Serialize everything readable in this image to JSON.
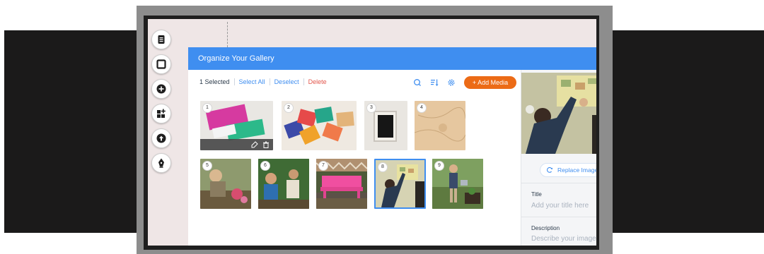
{
  "panel": {
    "title": "Organize Your Gallery",
    "selected_count": "1 Selected",
    "select_all": "Select All",
    "deselect": "Deselect",
    "delete": "Delete",
    "add_media": "+ Add Media"
  },
  "toolbar": {
    "items": [
      "pages-icon",
      "background-icon",
      "add-icon",
      "apps-icon",
      "upload-icon",
      "pen-icon"
    ]
  },
  "gallery": {
    "items": [
      {
        "number": "1",
        "selected": false
      },
      {
        "number": "2",
        "selected": false
      },
      {
        "number": "3",
        "selected": false
      },
      {
        "number": "4",
        "selected": false
      },
      {
        "number": "5",
        "selected": false
      },
      {
        "number": "6",
        "selected": false
      },
      {
        "number": "7",
        "selected": false
      },
      {
        "number": "8",
        "selected": true
      },
      {
        "number": "9",
        "selected": false
      }
    ]
  },
  "details": {
    "replace_image": "Replace Image",
    "title_label": "Title",
    "title_placeholder": "Add your title here",
    "description_label": "Description",
    "description_placeholder": "Describe your image"
  },
  "colors": {
    "accent": "#3f8ef0",
    "add_media": "#ec6b16",
    "delete": "#e2574c",
    "band": "#1b1a1a"
  }
}
